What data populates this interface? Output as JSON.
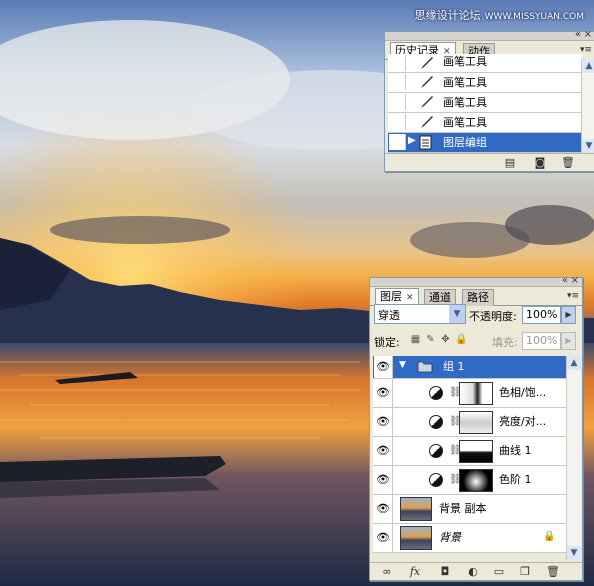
{
  "watermark": {
    "text": "思缘设计论坛",
    "site": "WWW.MISSYUAN.COM"
  },
  "history_panel": {
    "tabs": [
      "历史记录",
      "动作"
    ],
    "rows": [
      {
        "label": "画笔工具",
        "icon": "brush-icon"
      },
      {
        "label": "画笔工具",
        "icon": "brush-icon"
      },
      {
        "label": "画笔工具",
        "icon": "brush-icon"
      },
      {
        "label": "画笔工具",
        "icon": "brush-icon"
      },
      {
        "label": "图层编组",
        "icon": "layer-group-icon",
        "selected": true
      }
    ],
    "close_glyph": "×",
    "collapse_glyph": "«"
  },
  "layers_panel": {
    "tabs": [
      "图层",
      "通道",
      "路径"
    ],
    "blend_mode": "穿透",
    "opacity_label": "不透明度:",
    "opacity_value": "100%",
    "lock_label": "锁定:",
    "fill_label": "填充:",
    "fill_value": "100%",
    "layers": [
      {
        "name": "组 1",
        "type": "group",
        "selected": true
      },
      {
        "name": "色相/饱...",
        "type": "adjustment"
      },
      {
        "name": "亮度/对...",
        "type": "adjustment"
      },
      {
        "name": "曲线 1",
        "type": "adjustment"
      },
      {
        "name": "色阶 1",
        "type": "adjustment"
      },
      {
        "name": "背景 副本",
        "type": "image"
      },
      {
        "name": "背景",
        "type": "image",
        "locked": true
      }
    ],
    "footer_icons": [
      "link-icon",
      "fx-icon",
      "mask-icon",
      "adjustment-icon",
      "new-group-icon",
      "new-layer-icon",
      "trash-icon"
    ],
    "fx_label": "fx"
  },
  "colors": {
    "selection": "#316ac5",
    "panel_bg": "#ece9d8"
  }
}
